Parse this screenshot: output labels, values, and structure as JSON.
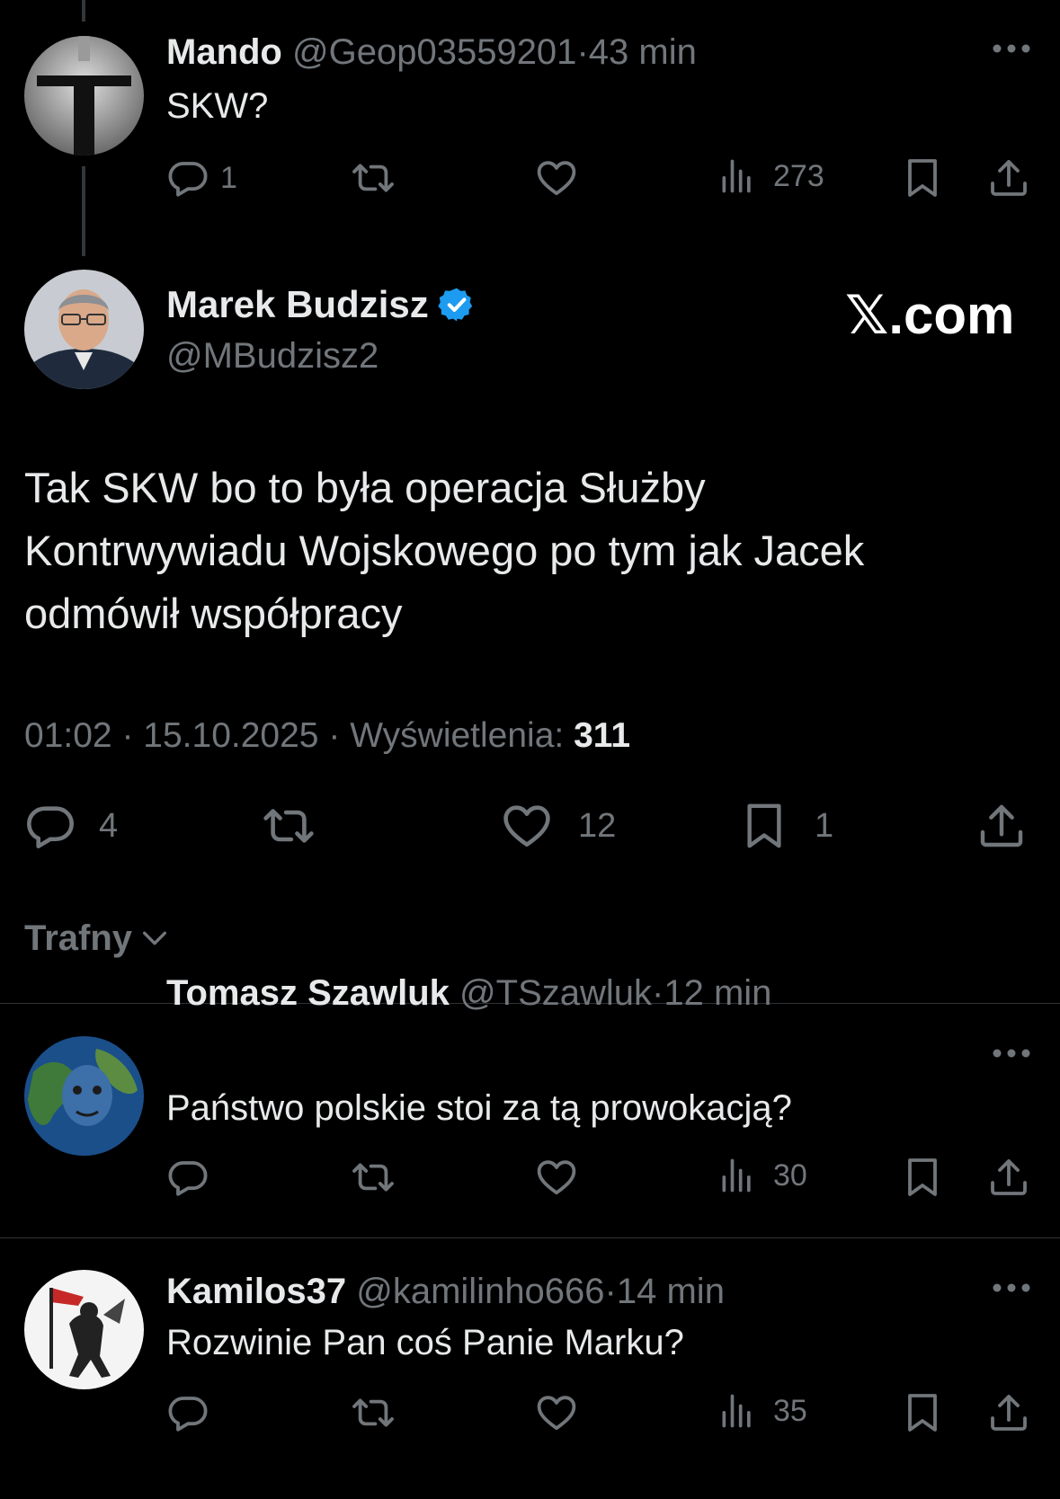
{
  "reply_parent": {
    "display_name": "Mando",
    "handle": "@Geop03559201",
    "dot": "·",
    "time": "43 min",
    "text": "SKW?",
    "replies": "1",
    "views": "273"
  },
  "main_post": {
    "display_name": "Marek Budzisz",
    "handle": "@MBudzisz2",
    "watermark": "𝕏.com",
    "text_lines": [
      "Tak SKW bo to była operacja Służby",
      "Kontrwywiadu Wojskowego po tym jak Jacek",
      "odmówił współpracy"
    ],
    "time": "01:02",
    "dot": "·",
    "date": "15.10.2025",
    "views_label": "Wyświetlenia:",
    "views_count": "311",
    "replies": "4",
    "likes": "12",
    "bookmarks": "1"
  },
  "sort": {
    "label": "Trafny"
  },
  "replies": [
    {
      "display_name": "Tomasz Szawluk",
      "handle": "@TSzawluk",
      "dot": "·",
      "time": "12 min",
      "text": "Państwo polskie stoi za tą prowokacją?",
      "views": "30"
    },
    {
      "display_name": "Kamilos37",
      "handle": "@kamilinho666",
      "dot": "·",
      "time": "14 min",
      "text": "Rozwinie Pan coś Panie Marku?",
      "views": "35"
    }
  ],
  "colors": {
    "background": "#000000",
    "text": "#e7e9ea",
    "muted": "#71767b",
    "verified": "#1d9bf0",
    "divider": "#2f3336"
  },
  "icons": [
    "more-icon",
    "reply-icon",
    "repost-icon",
    "like-icon",
    "views-icon",
    "bookmark-icon",
    "share-icon",
    "verified-badge-icon",
    "chevron-down-icon"
  ]
}
